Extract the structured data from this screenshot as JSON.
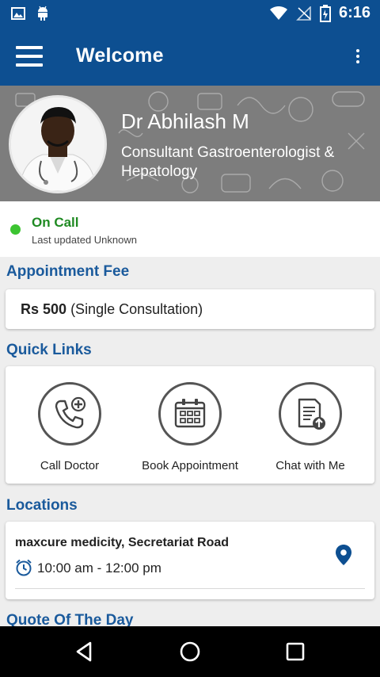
{
  "status_bar": {
    "time": "6:16",
    "icons": [
      "image-icon",
      "android-icon",
      "wifi-icon",
      "no-signal-icon",
      "battery-icon"
    ]
  },
  "app_bar": {
    "title": "Welcome"
  },
  "doctor": {
    "name": "Dr Abhilash M",
    "title": "Consultant Gastroenterologist & Hepatology"
  },
  "availability": {
    "status": "On Call",
    "updated": "Last updated Unknown",
    "status_color": "#3cc431"
  },
  "appointment_fee": {
    "heading": "Appointment Fee",
    "amount": "Rs 500",
    "note": "(Single Consultation)"
  },
  "quick_links": {
    "heading": "Quick Links",
    "items": [
      {
        "label": "Call Doctor",
        "icon": "phone-plus-icon"
      },
      {
        "label": "Book Appointment",
        "icon": "calendar-icon"
      },
      {
        "label": "Chat with Me",
        "icon": "document-upload-icon"
      }
    ]
  },
  "locations": {
    "heading": "Locations",
    "items": [
      {
        "name": "maxcure medicity, Secretariat Road",
        "time": "10:00 am - 12:00 pm"
      }
    ]
  },
  "quote": {
    "heading": "Quote Of The Day"
  },
  "colors": {
    "primary": "#0d4f91",
    "section_heading": "#1a5a9c",
    "background": "#eeeeee"
  }
}
